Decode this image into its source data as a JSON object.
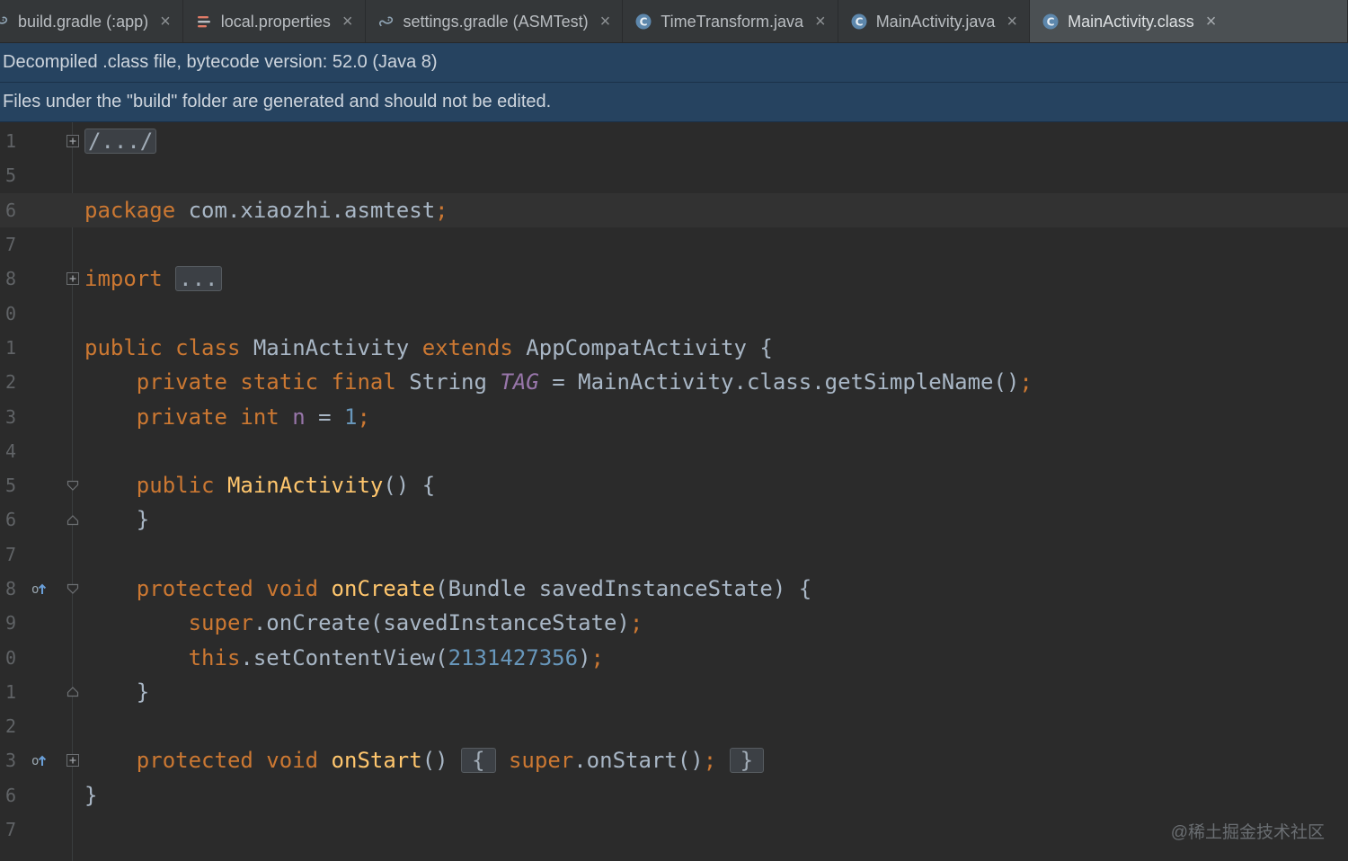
{
  "colors": {
    "editor_bg": "#2b2b2b",
    "keyword_orange": "#cc7832",
    "plain_text": "#a9b7c6",
    "field_purple": "#9876aa",
    "number_blue": "#6897bb",
    "method_yellow": "#ffc66d",
    "banner_bg": "#264360",
    "tab_active_bg": "#4b5053",
    "gutter_gray": "#606366"
  },
  "tab_bar": {
    "tabs": [
      {
        "label": "build.gradle (:app)",
        "icon": "gradle-icon",
        "active": false,
        "close_glyph": "×"
      },
      {
        "label": "local.properties",
        "icon": "properties-icon",
        "active": false,
        "close_glyph": "×"
      },
      {
        "label": "settings.gradle (ASMTest)",
        "icon": "gradle-icon",
        "active": false,
        "close_glyph": "×"
      },
      {
        "label": "TimeTransform.java",
        "icon": "java-class-icon",
        "active": false,
        "close_glyph": "×"
      },
      {
        "label": "MainActivity.java",
        "icon": "java-class-icon",
        "active": false,
        "close_glyph": "×"
      },
      {
        "label": "MainActivity.class",
        "icon": "java-class-icon",
        "active": true,
        "close_glyph": "×"
      }
    ]
  },
  "banners": [
    {
      "text": "Decompiled .class file, bytecode version: 52.0 (Java 8)"
    },
    {
      "text": "Files under the \"build\" folder are generated and should not be edited."
    }
  ],
  "editor": {
    "lines": [
      {
        "num": "1",
        "fold": "plus",
        "tokens": [
          {
            "t": "/.../",
            "s": "fold"
          }
        ]
      },
      {
        "num": "5",
        "tokens": []
      },
      {
        "num": "6",
        "caret": true,
        "tokens": [
          {
            "t": "package",
            "s": "kw"
          },
          {
            "t": " com.xiaozhi.asmtest",
            "s": "plain"
          },
          {
            "t": ";",
            "s": "semi"
          }
        ]
      },
      {
        "num": "7",
        "tokens": []
      },
      {
        "num": "8",
        "fold": "plus",
        "tokens": [
          {
            "t": "import",
            "s": "kw"
          },
          {
            "t": " ",
            "s": "plain"
          },
          {
            "t": "...",
            "s": "fold"
          }
        ]
      },
      {
        "num": "0",
        "tokens": []
      },
      {
        "num": "1",
        "tokens": [
          {
            "t": "public",
            "s": "kw"
          },
          {
            "t": " ",
            "s": "plain"
          },
          {
            "t": "class",
            "s": "kw"
          },
          {
            "t": " MainActivity ",
            "s": "plain"
          },
          {
            "t": "extends",
            "s": "kw"
          },
          {
            "t": " AppCompatActivity {",
            "s": "plain"
          }
        ]
      },
      {
        "num": "2",
        "tokens": [
          {
            "t": "    ",
            "s": "plain"
          },
          {
            "t": "private",
            "s": "kw"
          },
          {
            "t": " ",
            "s": "plain"
          },
          {
            "t": "static",
            "s": "kw"
          },
          {
            "t": " ",
            "s": "plain"
          },
          {
            "t": "final",
            "s": "kw"
          },
          {
            "t": " String ",
            "s": "plain"
          },
          {
            "t": "TAG",
            "s": "sfield"
          },
          {
            "t": " = MainActivity.class.getSimpleName()",
            "s": "plain"
          },
          {
            "t": ";",
            "s": "semi"
          }
        ]
      },
      {
        "num": "3",
        "tokens": [
          {
            "t": "    ",
            "s": "plain"
          },
          {
            "t": "private",
            "s": "kw"
          },
          {
            "t": " ",
            "s": "plain"
          },
          {
            "t": "int",
            "s": "kw"
          },
          {
            "t": " ",
            "s": "plain"
          },
          {
            "t": "n",
            "s": "field"
          },
          {
            "t": " = ",
            "s": "plain"
          },
          {
            "t": "1",
            "s": "num"
          },
          {
            "t": ";",
            "s": "semi"
          }
        ]
      },
      {
        "num": "4",
        "tokens": []
      },
      {
        "num": "5",
        "fold": "start",
        "tokens": [
          {
            "t": "    ",
            "s": "plain"
          },
          {
            "t": "public",
            "s": "kw"
          },
          {
            "t": " ",
            "s": "plain"
          },
          {
            "t": "MainActivity",
            "s": "decl"
          },
          {
            "t": "() {",
            "s": "plain"
          }
        ]
      },
      {
        "num": "6",
        "fold": "end",
        "tokens": [
          {
            "t": "    }",
            "s": "plain"
          }
        ]
      },
      {
        "num": "7",
        "tokens": []
      },
      {
        "num": "8",
        "icon": "override",
        "fold": "start",
        "tokens": [
          {
            "t": "    ",
            "s": "plain"
          },
          {
            "t": "protected",
            "s": "kw"
          },
          {
            "t": " ",
            "s": "plain"
          },
          {
            "t": "void",
            "s": "kw"
          },
          {
            "t": " ",
            "s": "plain"
          },
          {
            "t": "onCreate",
            "s": "decl"
          },
          {
            "t": "(Bundle savedInstanceState) {",
            "s": "plain"
          }
        ]
      },
      {
        "num": "9",
        "tokens": [
          {
            "t": "        ",
            "s": "plain"
          },
          {
            "t": "super",
            "s": "kw"
          },
          {
            "t": ".onCreate(savedInstanceState)",
            "s": "plain"
          },
          {
            "t": ";",
            "s": "semi"
          }
        ]
      },
      {
        "num": "0",
        "tokens": [
          {
            "t": "        ",
            "s": "plain"
          },
          {
            "t": "this",
            "s": "kw"
          },
          {
            "t": ".setContentView(",
            "s": "plain"
          },
          {
            "t": "2131427356",
            "s": "num"
          },
          {
            "t": ")",
            "s": "plain"
          },
          {
            "t": ";",
            "s": "semi"
          }
        ]
      },
      {
        "num": "1",
        "fold": "end",
        "tokens": [
          {
            "t": "    }",
            "s": "plain"
          }
        ]
      },
      {
        "num": "2",
        "tokens": []
      },
      {
        "num": "3",
        "icon": "override",
        "fold": "plus",
        "tokens": [
          {
            "t": "    ",
            "s": "plain"
          },
          {
            "t": "protected",
            "s": "kw"
          },
          {
            "t": " ",
            "s": "plain"
          },
          {
            "t": "void",
            "s": "kw"
          },
          {
            "t": " ",
            "s": "plain"
          },
          {
            "t": "onStart",
            "s": "decl"
          },
          {
            "t": "() ",
            "s": "plain"
          },
          {
            "t": "{",
            "s": "foldb"
          },
          {
            "t": " ",
            "s": "plain"
          },
          {
            "t": "super",
            "s": "kw"
          },
          {
            "t": ".onStart()",
            "s": "plain"
          },
          {
            "t": ";",
            "s": "semi"
          },
          {
            "t": " ",
            "s": "plain"
          },
          {
            "t": "}",
            "s": "foldb"
          }
        ]
      },
      {
        "num": "6",
        "tokens": [
          {
            "t": "}",
            "s": "plain"
          }
        ]
      },
      {
        "num": "7",
        "tokens": []
      }
    ]
  },
  "watermark": "@稀土掘金技术社区"
}
